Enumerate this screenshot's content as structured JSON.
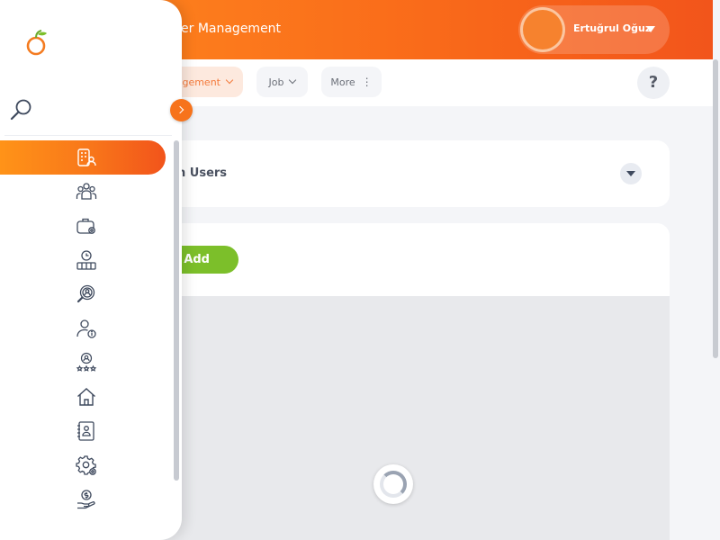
{
  "header": {
    "title": "er Management",
    "user_name": "Ertuğrul Oğuz"
  },
  "tabs": {
    "active_label": "gement",
    "job_label": "Job",
    "more_label": "More",
    "help_label": "?"
  },
  "filter_card": {
    "label": "n Users"
  },
  "actions": {
    "add_label": "Add"
  },
  "sidebar": {
    "items": [
      {
        "icon": "user-management-icon",
        "active": true
      },
      {
        "icon": "team-icon",
        "active": false
      },
      {
        "icon": "job-settings-icon",
        "active": false
      },
      {
        "icon": "shift-icon",
        "active": false
      },
      {
        "icon": "candidate-search-icon",
        "active": false
      },
      {
        "icon": "user-info-icon",
        "active": false
      },
      {
        "icon": "performance-icon",
        "active": false
      },
      {
        "icon": "home-icon",
        "active": false
      },
      {
        "icon": "contacts-icon",
        "active": false
      },
      {
        "icon": "settings-icon",
        "active": false
      },
      {
        "icon": "payment-icon",
        "active": false
      }
    ]
  },
  "colors": {
    "brand_orange": "#f7731b",
    "header_start": "#ff8a1e",
    "header_end": "#f2541b",
    "add_green": "#7cbf2a"
  }
}
